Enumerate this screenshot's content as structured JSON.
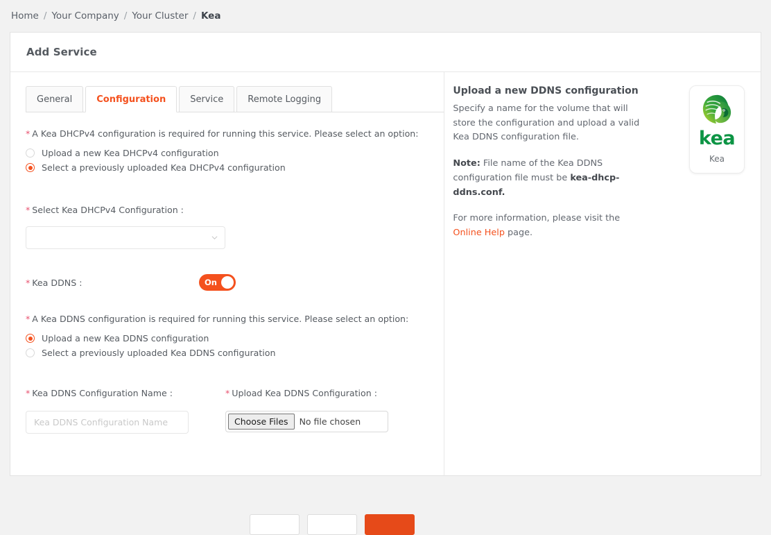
{
  "breadcrumb": {
    "items": [
      {
        "label": "Home",
        "current": false
      },
      {
        "label": "Your Company",
        "current": false
      },
      {
        "label": "Your Cluster",
        "current": false
      },
      {
        "label": "Kea",
        "current": true
      }
    ],
    "separator": "/"
  },
  "card": {
    "title": "Add Service"
  },
  "tabs": [
    {
      "label": "General",
      "active": false
    },
    {
      "label": "Configuration",
      "active": true
    },
    {
      "label": "Service",
      "active": false
    },
    {
      "label": "Remote Logging",
      "active": false
    }
  ],
  "form": {
    "dhcpv4_prompt": "A Kea DHCPv4 configuration is required for running this service. Please select an option:",
    "dhcpv4_options": [
      {
        "label": "Upload a new Kea DHCPv4 configuration",
        "checked": false
      },
      {
        "label": "Select a previously uploaded Kea DHCPv4 configuration",
        "checked": true
      }
    ],
    "select_dhcpv4_label": "Select Kea DHCPv4 Configuration :",
    "select_dhcpv4_value": "",
    "select_icon": "chevron-down-icon",
    "kea_ddns_label": "Kea DDNS :",
    "kea_ddns_toggle_state": "On",
    "ddns_prompt": "A Kea DDNS configuration is required for running this service. Please select an option:",
    "ddns_options": [
      {
        "label": "Upload a new Kea DDNS configuration",
        "checked": true
      },
      {
        "label": "Select a previously uploaded Kea DDNS configuration",
        "checked": false
      }
    ],
    "ddns_name_label": "Kea DDNS Configuration Name :",
    "ddns_name_value": "",
    "ddns_name_placeholder": "Kea DDNS Configuration Name",
    "upload_ddns_label": "Upload Kea DDNS Configuration :",
    "file_button_label": "Choose Files",
    "file_status": "No file chosen",
    "required_marker": "*"
  },
  "footer": {
    "buttons": [
      {
        "name": "back-button",
        "primary": false
      },
      {
        "name": "cancel-button",
        "primary": false
      },
      {
        "name": "next-button",
        "primary": true
      }
    ]
  },
  "help": {
    "title": "Upload a new DDNS configuration",
    "paragraph1": "Specify a name for the volume that will store the configuration and upload a valid Kea DDNS configuration file.",
    "note_prefix": "Note:",
    "note_text": " File name of the Kea DDNS configuration file must be ",
    "note_filename": "kea-dhcp-ddns.conf.",
    "info_text": "For more information, please visit the ",
    "link_text": "Online Help",
    "info_suffix": " page."
  },
  "logo": {
    "wordmark": "kea",
    "caption": "Kea",
    "icon": "kea-bird-logo-icon"
  },
  "colors": {
    "accent": "#f4511e",
    "primary_button": "#e64a19",
    "required": "#e8506e",
    "logo_green": "#0c9444",
    "page_background": "#f2f2f2"
  }
}
